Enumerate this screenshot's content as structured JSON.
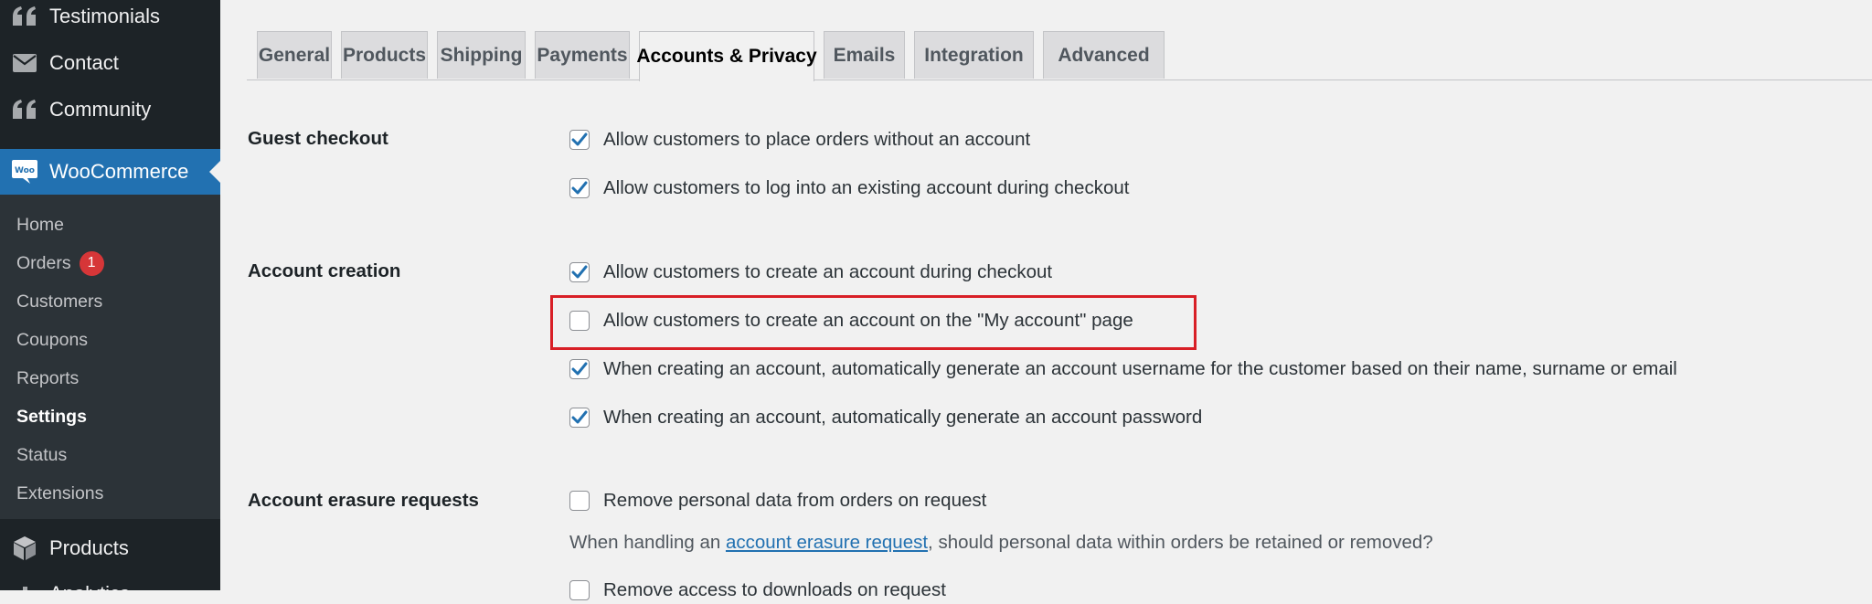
{
  "sidebar": {
    "top_items": [
      {
        "label": "Testimonials",
        "icon": "quote-icon"
      },
      {
        "label": "Contact",
        "icon": "envelope-icon"
      },
      {
        "label": "Community",
        "icon": "quote-icon"
      }
    ],
    "woocommerce": {
      "label": "WooCommerce",
      "icon": "woo-icon",
      "icon_text": "Woo"
    },
    "submenu": [
      {
        "label": "Home"
      },
      {
        "label": "Orders",
        "badge": "1"
      },
      {
        "label": "Customers"
      },
      {
        "label": "Coupons"
      },
      {
        "label": "Reports"
      },
      {
        "label": "Settings",
        "current": true
      },
      {
        "label": "Status"
      },
      {
        "label": "Extensions"
      }
    ],
    "bottom_items": [
      {
        "label": "Products",
        "icon": "box-icon"
      },
      {
        "label": "Analytics",
        "icon": "chart-icon"
      }
    ]
  },
  "tabs": [
    {
      "label": "General"
    },
    {
      "label": "Products"
    },
    {
      "label": "Shipping"
    },
    {
      "label": "Payments"
    },
    {
      "label": "Accounts & Privacy",
      "active": true
    },
    {
      "label": "Emails"
    },
    {
      "label": "Integration"
    },
    {
      "label": "Advanced"
    }
  ],
  "sections": {
    "guest_checkout": {
      "title": "Guest checkout",
      "options": [
        {
          "label": "Allow customers to place orders without an account",
          "checked": true
        },
        {
          "label": "Allow customers to log into an existing account during checkout",
          "checked": true
        }
      ]
    },
    "account_creation": {
      "title": "Account creation",
      "options": [
        {
          "label": "Allow customers to create an account during checkout",
          "checked": true
        },
        {
          "label": "Allow customers to create an account on the \"My account\" page",
          "checked": false
        },
        {
          "label": "When creating an account, automatically generate an account username for the customer based on their name, surname or email",
          "checked": true
        },
        {
          "label": "When creating an account, automatically generate an account password",
          "checked": true
        }
      ]
    },
    "account_erasure": {
      "title": "Account erasure requests",
      "options": [
        {
          "label": "Remove personal data from orders on request",
          "checked": false
        },
        {
          "label": "Remove access to downloads on request",
          "checked": false
        }
      ],
      "description": {
        "before": "When handling an ",
        "link": "account erasure request",
        "after": ", should personal data within orders be retained or removed?"
      }
    }
  },
  "colors": {
    "sidebar_bg": "#1d2327",
    "submenu_bg": "#2c3338",
    "accent": "#2271b1",
    "badge": "#d63638",
    "highlight": "#d81f26",
    "checkbox_check": "#2271b1"
  }
}
